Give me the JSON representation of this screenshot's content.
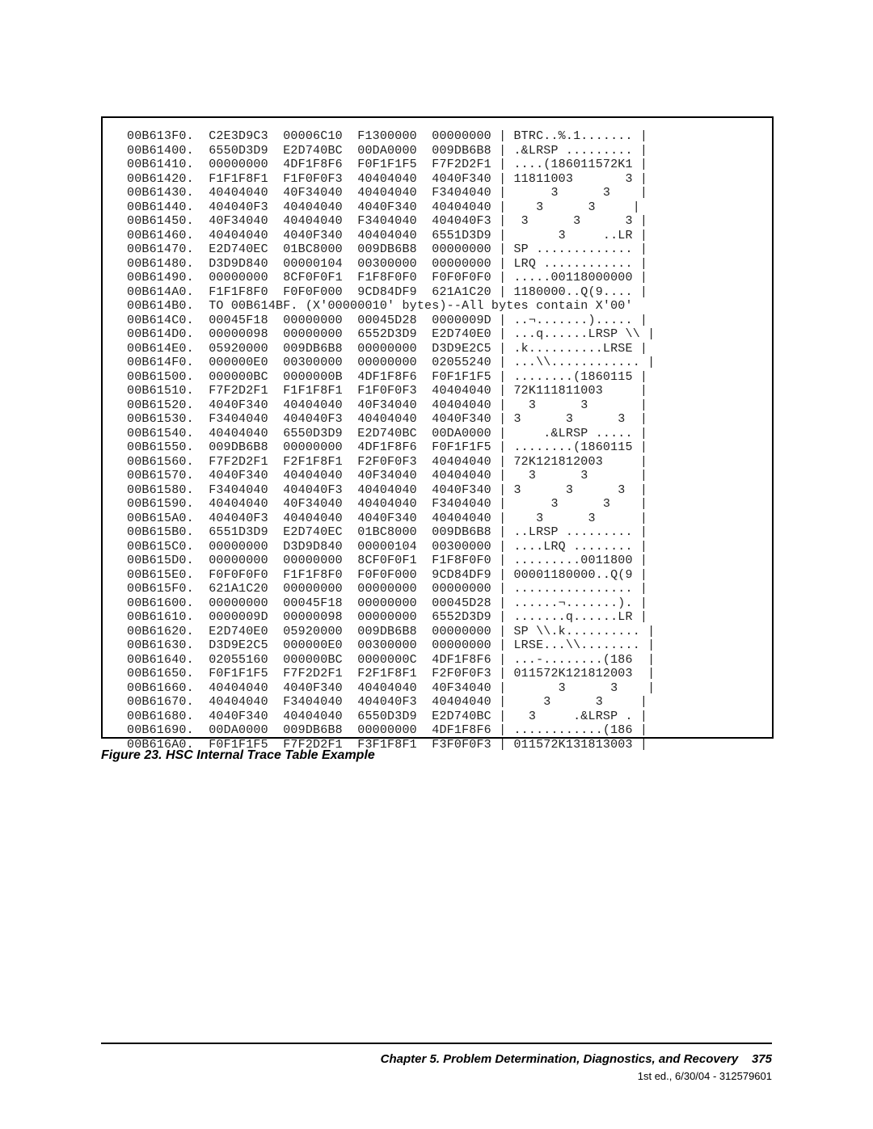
{
  "figure_caption": "Figure 23. HSC Internal Trace Table Example",
  "footer": {
    "chapter": "Chapter 5. Problem Determination, Diagnostics, and Recovery",
    "page": "375",
    "edition": "1st ed., 6/30/04 - 312579601"
  },
  "dump_lines": [
    "00B613F0.  C2E3D9C3  00006C10  F1300000  00000000 | BTRC..%.1....... |",
    "00B61400.  6550D3D9  E2D740BC  00DA0000  009DB6B8 | .&LRSP ......... |",
    "00B61410.  00000000  4DF1F8F6  F0F1F1F5  F7F2D2F1 | ....(186011572K1 |",
    "00B61420.  F1F1F8F1  F1F0F0F3  40404040  4040F340 | 11811003       3 |",
    "00B61430.  40404040  40F34040  40404040  F3404040 |      3      3    |",
    "00B61440.  404040F3  40404040  4040F340  40404040 |    3      3     |",
    "00B61450.  40F34040  40404040  F3404040  404040F3 |  3      3      3 |",
    "00B61460.  40404040  4040F340  40404040  6551D3D9 |       3     ..LR |",
    "00B61470.  E2D740EC  01BC8000  009DB6B8  00000000 | SP ............. |",
    "00B61480.  D3D9D840  00000104  00300000  00000000 | LRQ ............ |",
    "00B61490.  00000000  8CF0F0F1  F1F8F0F0  F0F0F0F0 | .....00118000000 |",
    "00B614A0.  F1F1F8F0  F0F0F000  9CD84DF9  621A1C20 | 1180000..Q(9.... |",
    "00B614B0.  TO 00B614BF. (X'00000010' bytes)--All bytes contain X'00'",
    "00B614C0.  00045F18  00000000  00045D28  0000009D | ..¬.......)..... |",
    "00B614D0.  00000098  00000000  6552D3D9  E2D740E0 | ...q......LRSP \\\\ |",
    "00B614E0.  05920000  009DB6B8  00000000  D3D9E2C5 | .k..........LRSE |",
    "00B614F0.  000000E0  00300000  00000000  02055240 | ...\\\\............ |",
    "00B61500.  000000BC  0000000B  4DF1F8F6  F0F1F1F5 | ........(1860115 |",
    "00B61510.  F7F2D2F1  F1F1F8F1  F1F0F0F3  40404040 | 72K111811003     |",
    "00B61520.  4040F340  40404040  40F34040  40404040 |   3      3       |",
    "00B61530.  F3404040  404040F3  40404040  4040F340 | 3      3      3  |",
    "00B61540.  40404040  6550D3D9  E2D740BC  00DA0000 |     .&LRSP ..... |",
    "00B61550.  009DB6B8  00000000  4DF1F8F6  F0F1F1F5 | ........(1860115 |",
    "00B61560.  F7F2D2F1  F2F1F8F1  F2F0F0F3  40404040 | 72K121812003     |",
    "00B61570.  4040F340  40404040  40F34040  40404040 |   3      3       |",
    "00B61580.  F3404040  404040F3  40404040  4040F340 | 3      3      3  |",
    "00B61590.  40404040  40F34040  40404040  F3404040 |      3      3    |",
    "00B615A0.  404040F3  40404040  4040F340  40404040 |    3      3      |",
    "00B615B0.  6551D3D9  E2D740EC  01BC8000  009DB6B8 | ..LRSP ......... |",
    "00B615C0.  00000000  D3D9D840  00000104  00300000 | ....LRQ ........ |",
    "00B615D0.  00000000  00000000  8CF0F0F1  F1F8F0F0 | .........0011800 |",
    "00B615E0.  F0F0F0F0  F1F1F8F0  F0F0F000  9CD84DF9 | 00001180000..Q(9 |",
    "00B615F0.  621A1C20  00000000  00000000  00000000 | ................ |",
    "00B61600.  00000000  00045F18  00000000  00045D28 | ......¬.......). |",
    "00B61610.  0000009D  00000098  00000000  6552D3D9 | .......q......LR |",
    "00B61620.  E2D740E0  05920000  009DB6B8  00000000 | SP \\\\.k.......... |",
    "00B61630.  D3D9E2C5  000000E0  00300000  00000000 | LRSE...\\\\........ |",
    "00B61640.  02055160  000000BC  0000000C  4DF1F8F6 | ...-........(186  |",
    "00B61650.  F0F1F1F5  F7F2D2F1  F2F1F8F1  F2F0F0F3 | 011572K121812003  |",
    "00B61660.  40404040  4040F340  40404040  40F34040 |       3      3    |",
    "00B61670.  40404040  F3404040  404040F3  40404040 |     3      3     |",
    "00B61680.  4040F340  40404040  6550D3D9  E2D740BC |   3     .&LRSP . |",
    "00B61690.  00DA0000  009DB6B8  00000000  4DF1F8F6 | ............(186 |",
    "00B616A0.  F0F1F1F5  F7F2D2F1  F3F1F8F1  F3F0F0F3 | 011572K131813003 |"
  ]
}
